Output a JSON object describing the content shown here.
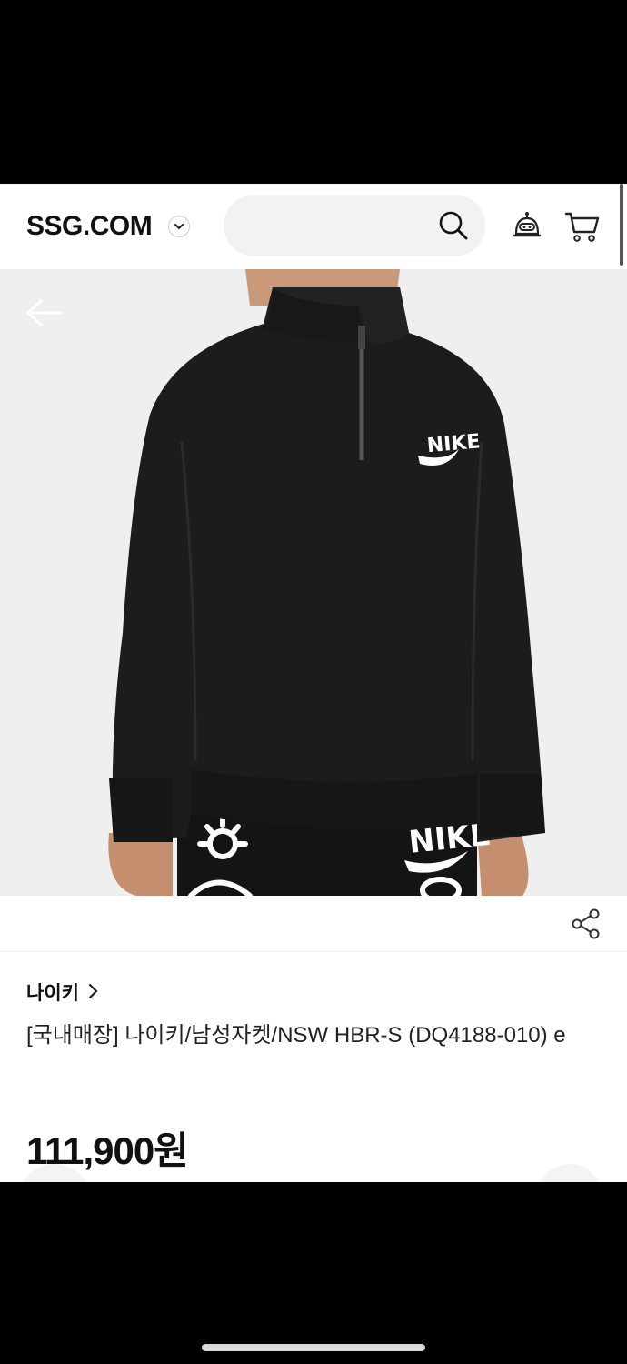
{
  "header": {
    "logo": "SSG.COM",
    "search": {
      "placeholder": ""
    }
  },
  "product": {
    "brand": "나이키",
    "title": "[국내매장] 나이키/남성자켓/NSW HBR-S (DQ4188-010) e",
    "price": "111,900원",
    "image_description_icons": [
      "nike-logo-icon"
    ]
  },
  "icons": {
    "logo_dropdown": "chevron-down-icon",
    "search": "search-icon",
    "chatbot": "robot-icon",
    "cart": "cart-icon",
    "back": "back-arrow-icon",
    "share": "share-icon",
    "brand_link": "chevron-right-icon"
  },
  "colors": {
    "primary_text": "#111111",
    "search_bg": "#f2f2f2",
    "image_bg": "#efefef"
  }
}
